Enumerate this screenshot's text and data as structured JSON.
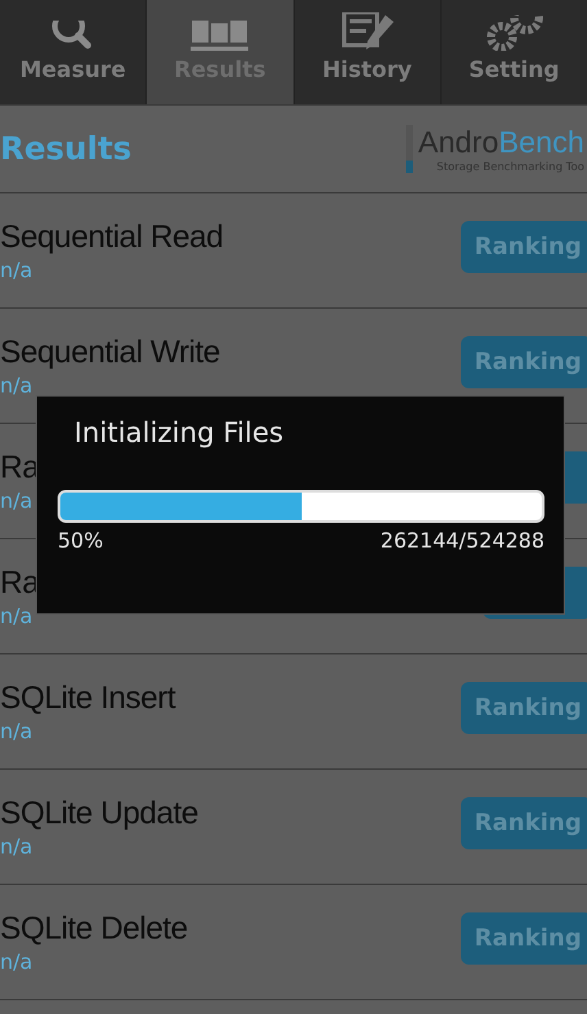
{
  "tabs": [
    {
      "label": "Measure",
      "kind": "search",
      "selected": false
    },
    {
      "label": "Results",
      "kind": "chart",
      "selected": true
    },
    {
      "label": "History",
      "kind": "document",
      "selected": false
    },
    {
      "label": "Setting",
      "kind": "gears",
      "selected": false
    }
  ],
  "header": {
    "title": "Results",
    "logo_dark": "Andro",
    "logo_light": "Bench",
    "tagline": "Storage Benchmarking Too"
  },
  "results": [
    {
      "name": "Sequential Read",
      "value": "n/a",
      "button": "Ranking"
    },
    {
      "name": "Sequential Write",
      "value": "n/a",
      "button": "Ranking"
    },
    {
      "name": "Ra",
      "value": "n/a",
      "kind": "covered"
    },
    {
      "name": "Ra",
      "value": "n/a",
      "kind": "covered"
    },
    {
      "name": "SQLite Insert",
      "value": "n/a",
      "button": "Ranking"
    },
    {
      "name": "SQLite Update",
      "value": "n/a",
      "button": "Ranking"
    },
    {
      "name": "SQLite Delete",
      "value": "n/a",
      "button": "Ranking"
    }
  ],
  "dialog": {
    "title": "Initializing Files",
    "level": 0.5,
    "percent": "50%",
    "count": "262144/524288"
  }
}
